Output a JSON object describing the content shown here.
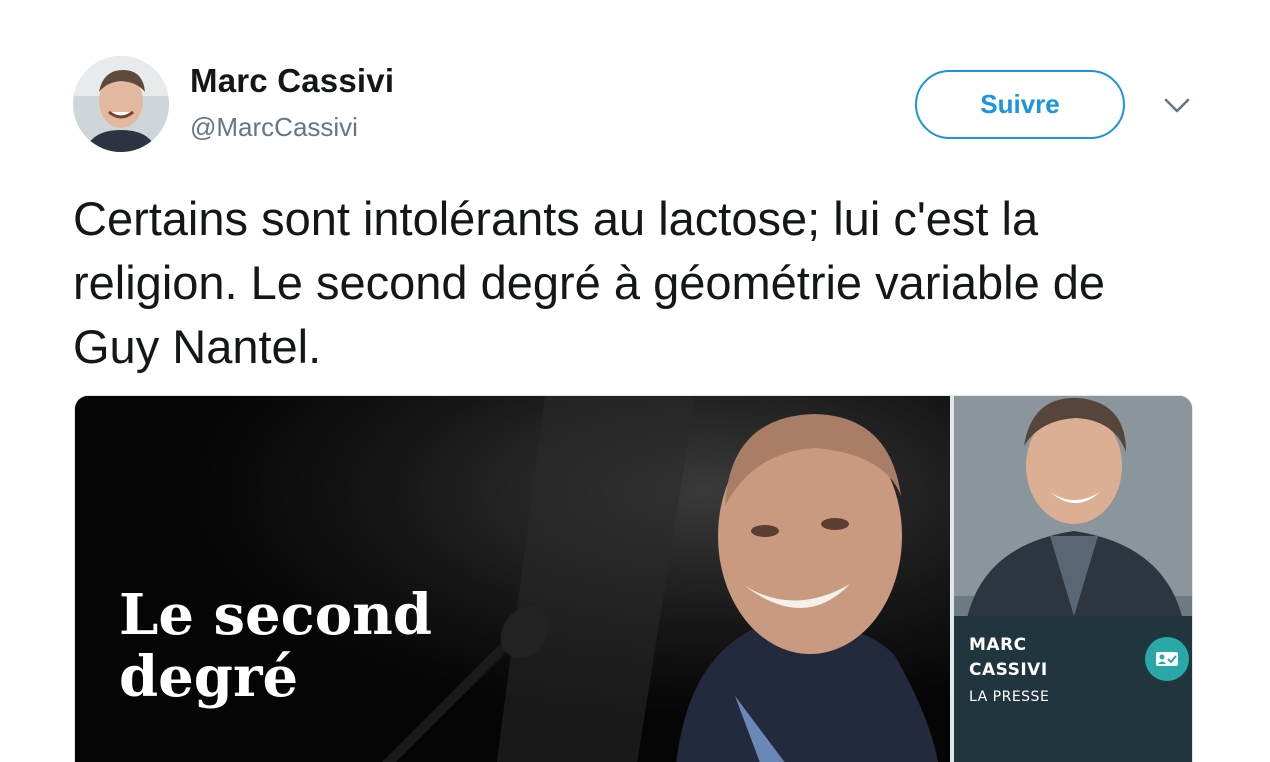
{
  "user": {
    "display_name": "Marc Cassivi",
    "handle": "@MarcCassivi",
    "avatar_icon": "profile-photo"
  },
  "actions": {
    "follow_label": "Suivre",
    "more_icon": "chevron-down-icon"
  },
  "tweet": {
    "text": "Certains sont intolérants au lactose; lui c'est la religion. Le second degré à géométrie variable de Guy Nantel."
  },
  "media": {
    "left_image": {
      "overlay_title": "Le second\ndegré"
    },
    "right_image": {
      "name": "MARC\nCASSIVI",
      "outlet": "LA PRESSE",
      "badge_icon": "id-card-icon"
    }
  },
  "colors": {
    "accent": "#1b95e0",
    "text": "#14171a",
    "secondary_text": "#657786",
    "badge": "#2aa7a7"
  }
}
